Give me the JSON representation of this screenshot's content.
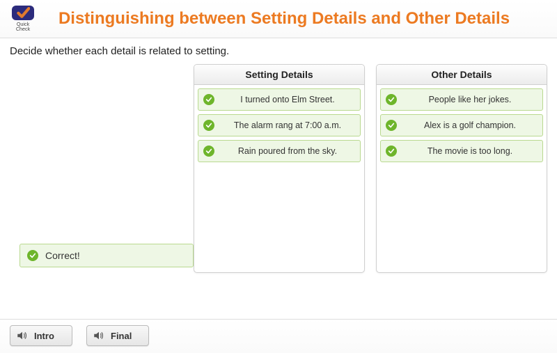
{
  "logo": {
    "line1": "Quick",
    "line2": "Check"
  },
  "title": "Distinguishing between Setting Details and Other Details",
  "instruction": "Decide whether each detail is related to setting.",
  "bins": [
    {
      "header": "Setting Details",
      "items": [
        "I turned onto Elm Street.",
        "The alarm rang at 7:00 a.m.",
        "Rain poured from the sky."
      ]
    },
    {
      "header": "Other Details",
      "items": [
        "People like her jokes.",
        "Alex is a golf champion.",
        "The movie is too long."
      ]
    }
  ],
  "feedback": "Correct!",
  "buttons": {
    "intro": "Intro",
    "final": "Final"
  }
}
